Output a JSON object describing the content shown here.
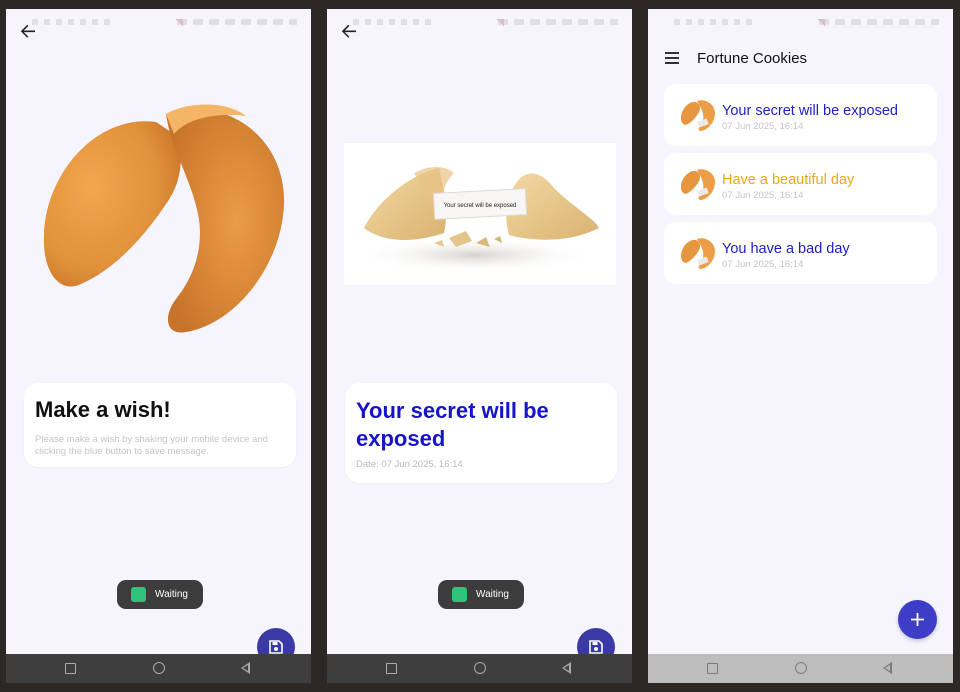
{
  "screen1": {
    "card_title": "Make a wish!",
    "card_description": "Please make a wish by shaking your mobile device and clicking the blue button to save message.",
    "toast_label": "Waiting"
  },
  "screen2": {
    "photo_caption": "Your secret will be exposed",
    "fortune_text": "Your secret will be exposed",
    "date_text": "Date: 07 Jun 2025, 16:14",
    "toast_label": "Waiting",
    "fortune_color": "#1515c7"
  },
  "screen3": {
    "title": "Fortune Cookies",
    "items": [
      {
        "text": "Your secret will be exposed",
        "date": "07 Jun 2025, 16:14",
        "color": "#1e1ec4"
      },
      {
        "text": "Have a beautiful day",
        "date": "07 Jun 2025, 16:14",
        "color": "#e8a817"
      },
      {
        "text": "You have a bad day",
        "date": "07 Jun 2025, 16:14",
        "color": "#1e1ec4"
      }
    ]
  },
  "icons": {
    "back": "arrow-left-icon",
    "save": "floppy-disk-icon",
    "add": "plus-icon",
    "menu": "hamburger-menu-icon",
    "toast": "android-icon"
  },
  "colors": {
    "accent": "#3a3aa6",
    "background": "#f6f4fd"
  }
}
